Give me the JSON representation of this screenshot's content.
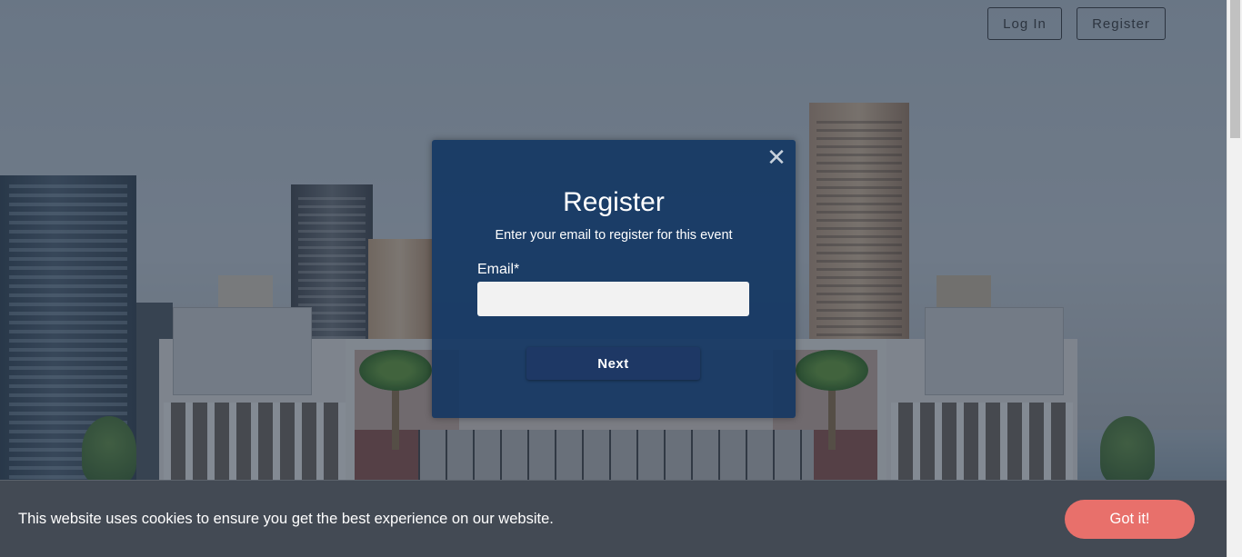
{
  "nav": {
    "login_label": "Log In",
    "register_label": "Register"
  },
  "modal": {
    "title": "Register",
    "subtitle": "Enter your email to register for this event",
    "email_label": "Email*",
    "email_value": "",
    "next_label": "Next",
    "close_icon": "close-icon"
  },
  "cookie": {
    "message": "This website uses cookies to ensure you get the best experience on our website.",
    "accept_label": "Got it!"
  },
  "colors": {
    "modal_bg": "#103462",
    "next_button": "#1e3865",
    "cookie_bar": "#434a54",
    "cookie_button": "#e8706b"
  }
}
